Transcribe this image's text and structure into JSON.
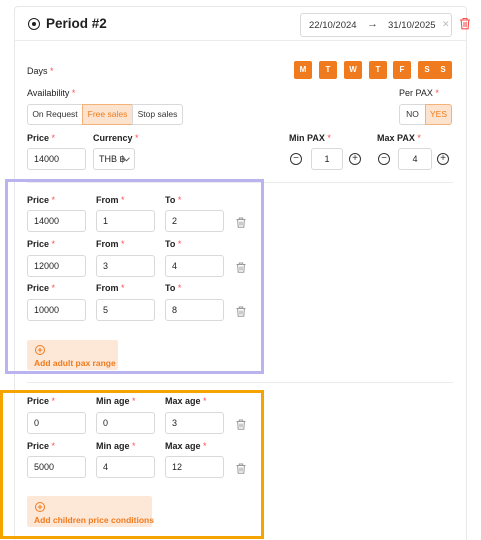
{
  "period": {
    "title": "Period #2",
    "date_start": "22/10/2024",
    "date_end": "31/10/2025",
    "arrow": "→",
    "clear": "✕"
  },
  "days": {
    "label": "Days",
    "items": [
      "M",
      "T",
      "W",
      "T",
      "F",
      "S",
      "S"
    ]
  },
  "availability": {
    "label": "Availability",
    "options": [
      "On Request",
      "Free sales",
      "Stop sales"
    ],
    "selected": "Free sales"
  },
  "per_pax": {
    "label": "Per PAX",
    "options": [
      "NO",
      "YES"
    ],
    "selected": "YES"
  },
  "base": {
    "price_label": "Price",
    "price_value": "14000",
    "currency_label": "Currency",
    "currency_value": "THB ฿",
    "min_pax_label": "Min PAX",
    "min_pax_value": "1",
    "max_pax_label": "Max PAX",
    "max_pax_value": "4"
  },
  "adult_ranges": {
    "labels": {
      "price": "Price",
      "from": "From",
      "to": "To"
    },
    "rows": [
      {
        "price": "14000",
        "from": "1",
        "to": "2"
      },
      {
        "price": "12000",
        "from": "3",
        "to": "4"
      },
      {
        "price": "10000",
        "from": "5",
        "to": "8"
      }
    ],
    "add_label": "Add adult pax range"
  },
  "children": {
    "labels": {
      "price": "Price",
      "min_age": "Min age",
      "max_age": "Max age"
    },
    "rows": [
      {
        "price": "0",
        "min_age": "0",
        "max_age": "3"
      },
      {
        "price": "5000",
        "min_age": "4",
        "max_age": "12"
      }
    ],
    "add_label": "Add children price conditions"
  },
  "colors": {
    "accent": "#f07b1e",
    "accent_light": "#fde3cd",
    "required": "#ff4d4f",
    "delete_red": "#ff4d4f",
    "frame_purple": "#b9b3f0",
    "frame_orange": "#f5a300"
  }
}
